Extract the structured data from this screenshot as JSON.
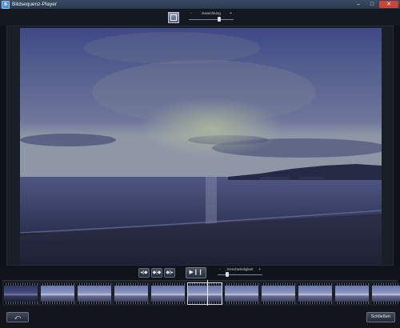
{
  "window": {
    "title": "Bildsequenz-Player",
    "app_icon_letter": "B",
    "minimize_glyph": "–",
    "maximize_glyph": "□",
    "close_glyph": "✕",
    "close_color": "#c7463c"
  },
  "top": {
    "logo_icon": "layers-icon",
    "slider_label": "Gewichtung",
    "slider_min_glyph": "-",
    "slider_max_glyph": "+",
    "slider_level": 0.7
  },
  "controls": {
    "step_back_glyph": "◂|◆",
    "step_mid_glyph": "◆|◆",
    "step_fwd_glyph": "◆|▸",
    "play_pause_glyph": "▶❙❙",
    "speed_label": "Geschwindigkeit",
    "speed_min_glyph": "-",
    "speed_max_glyph": "+",
    "speed_level": 0.2
  },
  "filmstrip": {
    "frame_count": 11,
    "selected_index": 5
  },
  "bottom": {
    "back_glyph": "⤺",
    "close_label": "Schließen"
  },
  "colors": {
    "accent": "#4a8fd8",
    "bg": "#0e1118"
  }
}
